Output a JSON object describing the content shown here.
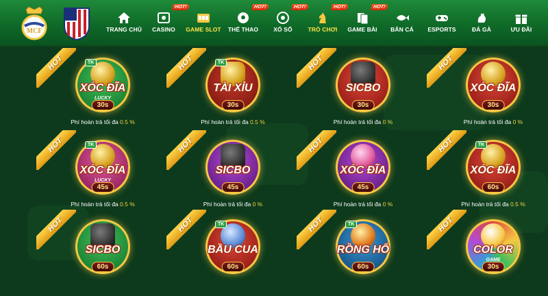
{
  "header": {
    "logos": [
      {
        "name": "real-madrid-logo"
      },
      {
        "name": "atletico-madrid-logo"
      }
    ],
    "nav": [
      {
        "label": "TRANG CHỦ",
        "icon": "home-icon",
        "hot": false,
        "active": false
      },
      {
        "label": "CASINO",
        "icon": "casino-icon",
        "hot": true,
        "active": false
      },
      {
        "label": "GAME SLOT",
        "icon": "slot-icon",
        "hot": false,
        "active": true
      },
      {
        "label": "THỂ THAO",
        "icon": "soccer-ball-icon",
        "hot": true,
        "active": false
      },
      {
        "label": "XỔ SỐ",
        "icon": "lottery-icon",
        "hot": true,
        "active": false
      },
      {
        "label": "TRÒ CHƠI",
        "icon": "chess-knight-icon",
        "hot": true,
        "active": true
      },
      {
        "label": "GAME BÀI",
        "icon": "cards-icon",
        "hot": true,
        "active": false
      },
      {
        "label": "BẮN CÁ",
        "icon": "fish-icon",
        "hot": false,
        "active": false
      },
      {
        "label": "ESPORTS",
        "icon": "gamepad-icon",
        "hot": false,
        "active": false
      },
      {
        "label": "ĐÁ GÀ",
        "icon": "rooster-icon",
        "hot": false,
        "active": false
      },
      {
        "label": "ƯU ĐÃI",
        "icon": "gift-icon",
        "hot": false,
        "active": false
      }
    ],
    "hot_label": "HOT!"
  },
  "ribbon_label": "HOT",
  "refund_prefix": "Phí hoàn trả tối đa",
  "games": [
    {
      "title": "XÓC ĐĨA",
      "sub": "LUCKY",
      "time": "30s",
      "tk": "TK",
      "refund": "0.5 %",
      "theme": "gold"
    },
    {
      "title": "TÀI XỈU",
      "sub": "",
      "time": "30s",
      "tk": "TK",
      "refund": "0.5 %",
      "theme": "red"
    },
    {
      "title": "SICBO",
      "sub": "",
      "time": "30s",
      "tk": "",
      "refund": "0 %",
      "theme": "red"
    },
    {
      "title": "XÓC ĐĨA",
      "sub": "",
      "time": "30s",
      "tk": "",
      "refund": "0 %",
      "theme": "red"
    },
    {
      "title": "XÓC ĐĨA",
      "sub": "LUCKY",
      "time": "45s",
      "tk": "TK",
      "refund": "0.5 %",
      "theme": "pink"
    },
    {
      "title": "SICBO",
      "sub": "",
      "time": "45s",
      "tk": "",
      "refund": "0 %",
      "theme": "purple"
    },
    {
      "title": "XÓC ĐĨA",
      "sub": "",
      "time": "45s",
      "tk": "",
      "refund": "0 %",
      "theme": "purple"
    },
    {
      "title": "XÓC ĐĨA",
      "sub": "",
      "time": "60s",
      "tk": "TK",
      "refund": "0.5 %",
      "theme": "red"
    },
    {
      "title": "SICBO",
      "sub": "",
      "time": "60s",
      "tk": "",
      "refund": "",
      "theme": "gold"
    },
    {
      "title": "BẦU CUA",
      "sub": "",
      "time": "60s",
      "tk": "TK",
      "refund": "",
      "theme": "red"
    },
    {
      "title": "RỒNG HỔ",
      "sub": "",
      "time": "60s",
      "tk": "TK",
      "refund": "",
      "theme": "teal"
    },
    {
      "title": "COLOR",
      "sub": "GAME",
      "time": "30s",
      "tk": "",
      "refund": "",
      "theme": "rainbow"
    }
  ],
  "colors": {
    "header_green": "#1f8a3a",
    "background": "#0d3a1c",
    "accent_yellow": "#ffe24a",
    "hot_orange": "#e44518",
    "ribbon_gold": "#f0b128"
  }
}
